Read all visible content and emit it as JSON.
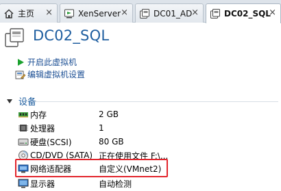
{
  "tabs": [
    {
      "label": "主页",
      "icon": "home-icon"
    },
    {
      "label": "XenServer",
      "icon": "server-icon"
    },
    {
      "label": "DC01_AD",
      "icon": "vm-icon"
    },
    {
      "label": "DC02_SQL",
      "icon": "vm-icon",
      "active": true
    }
  ],
  "tab_close_glyph": "×",
  "header": {
    "title": "DC02_SQL",
    "icon": "vm-icon"
  },
  "actions": [
    {
      "label": "开启此虚拟机",
      "icon": "play-icon"
    },
    {
      "label": "编辑虚拟机设置",
      "icon": "edit-settings-icon"
    }
  ],
  "section": {
    "title": "设备"
  },
  "devices": [
    {
      "name": "内存",
      "value": "2 GB",
      "icon": "memory-icon"
    },
    {
      "name": "处理器",
      "value": "1",
      "icon": "processor-icon"
    },
    {
      "name": "硬盘(SCSI)",
      "value": "80 GB",
      "icon": "hard-disk-icon"
    },
    {
      "name": "CD/DVD (SATA)",
      "value": "正在使用文件 F:\\...",
      "icon": "cd-dvd-icon"
    },
    {
      "name": "网络适配器",
      "value": "自定义(VMnet2)",
      "icon": "network-adapter-icon"
    },
    {
      "name": "显示器",
      "value": "自动检测",
      "icon": "display-icon"
    }
  ],
  "colors": {
    "accent": "#1d5d9f",
    "link": "#1c4f94",
    "highlight": "#e2232a",
    "play": "#1aa12e"
  }
}
